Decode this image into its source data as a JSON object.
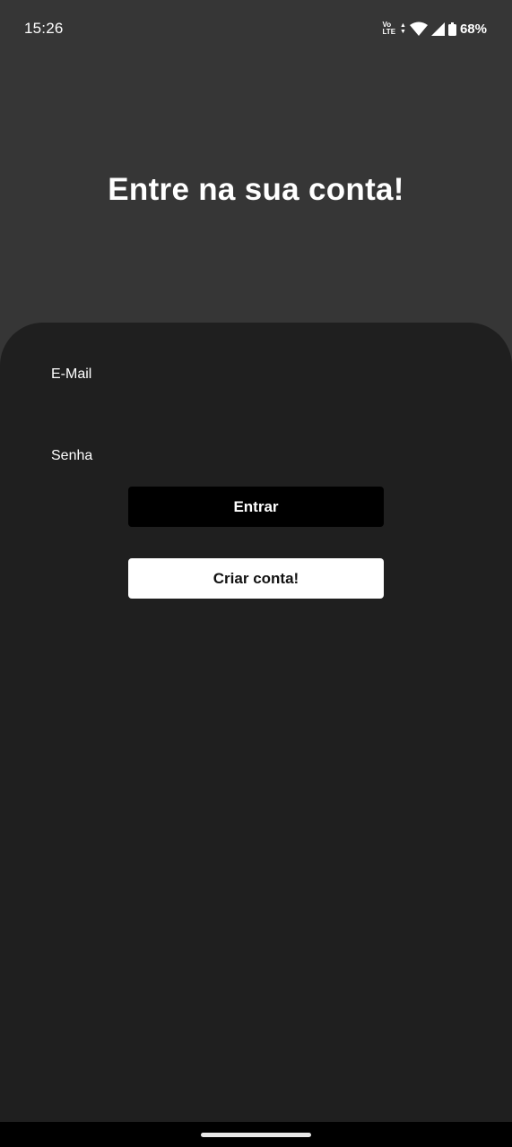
{
  "status_bar": {
    "time": "15:26",
    "network_top": "Vo",
    "network_bottom": "LTE",
    "battery_percent": "68%",
    "icons": [
      "volte-icon",
      "data-arrows-icon",
      "wifi-icon",
      "signal-icon",
      "battery-icon"
    ]
  },
  "header": {
    "title": "Entre na sua conta!"
  },
  "form": {
    "email_label": "E-Mail",
    "password_label": "Senha",
    "login_button": "Entrar",
    "create_account_button": "Criar conta!"
  },
  "colors": {
    "background_top": "#363636",
    "sheet_background": "#1f1f1f",
    "primary_button": "#000000",
    "secondary_button": "#ffffff",
    "text": "#ffffff"
  }
}
